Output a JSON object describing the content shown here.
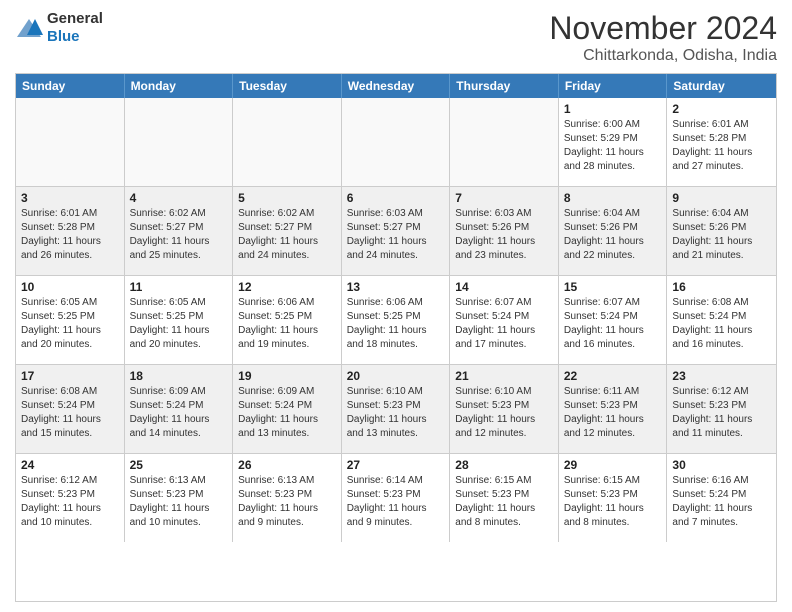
{
  "logo": {
    "general": "General",
    "blue": "Blue"
  },
  "title": "November 2024",
  "location": "Chittarkonda, Odisha, India",
  "days_of_week": [
    "Sunday",
    "Monday",
    "Tuesday",
    "Wednesday",
    "Thursday",
    "Friday",
    "Saturday"
  ],
  "weeks": [
    [
      {
        "day": "",
        "empty": true
      },
      {
        "day": "",
        "empty": true
      },
      {
        "day": "",
        "empty": true
      },
      {
        "day": "",
        "empty": true
      },
      {
        "day": "",
        "empty": true
      },
      {
        "day": "1",
        "sunrise": "6:00 AM",
        "sunset": "5:29 PM",
        "daylight": "11 hours and 28 minutes."
      },
      {
        "day": "2",
        "sunrise": "6:01 AM",
        "sunset": "5:28 PM",
        "daylight": "11 hours and 27 minutes."
      }
    ],
    [
      {
        "day": "3",
        "sunrise": "6:01 AM",
        "sunset": "5:28 PM",
        "daylight": "11 hours and 26 minutes."
      },
      {
        "day": "4",
        "sunrise": "6:02 AM",
        "sunset": "5:27 PM",
        "daylight": "11 hours and 25 minutes."
      },
      {
        "day": "5",
        "sunrise": "6:02 AM",
        "sunset": "5:27 PM",
        "daylight": "11 hours and 24 minutes."
      },
      {
        "day": "6",
        "sunrise": "6:03 AM",
        "sunset": "5:27 PM",
        "daylight": "11 hours and 24 minutes."
      },
      {
        "day": "7",
        "sunrise": "6:03 AM",
        "sunset": "5:26 PM",
        "daylight": "11 hours and 23 minutes."
      },
      {
        "day": "8",
        "sunrise": "6:04 AM",
        "sunset": "5:26 PM",
        "daylight": "11 hours and 22 minutes."
      },
      {
        "day": "9",
        "sunrise": "6:04 AM",
        "sunset": "5:26 PM",
        "daylight": "11 hours and 21 minutes."
      }
    ],
    [
      {
        "day": "10",
        "sunrise": "6:05 AM",
        "sunset": "5:25 PM",
        "daylight": "11 hours and 20 minutes."
      },
      {
        "day": "11",
        "sunrise": "6:05 AM",
        "sunset": "5:25 PM",
        "daylight": "11 hours and 20 minutes."
      },
      {
        "day": "12",
        "sunrise": "6:06 AM",
        "sunset": "5:25 PM",
        "daylight": "11 hours and 19 minutes."
      },
      {
        "day": "13",
        "sunrise": "6:06 AM",
        "sunset": "5:25 PM",
        "daylight": "11 hours and 18 minutes."
      },
      {
        "day": "14",
        "sunrise": "6:07 AM",
        "sunset": "5:24 PM",
        "daylight": "11 hours and 17 minutes."
      },
      {
        "day": "15",
        "sunrise": "6:07 AM",
        "sunset": "5:24 PM",
        "daylight": "11 hours and 16 minutes."
      },
      {
        "day": "16",
        "sunrise": "6:08 AM",
        "sunset": "5:24 PM",
        "daylight": "11 hours and 16 minutes."
      }
    ],
    [
      {
        "day": "17",
        "sunrise": "6:08 AM",
        "sunset": "5:24 PM",
        "daylight": "11 hours and 15 minutes."
      },
      {
        "day": "18",
        "sunrise": "6:09 AM",
        "sunset": "5:24 PM",
        "daylight": "11 hours and 14 minutes."
      },
      {
        "day": "19",
        "sunrise": "6:09 AM",
        "sunset": "5:24 PM",
        "daylight": "11 hours and 13 minutes."
      },
      {
        "day": "20",
        "sunrise": "6:10 AM",
        "sunset": "5:23 PM",
        "daylight": "11 hours and 13 minutes."
      },
      {
        "day": "21",
        "sunrise": "6:10 AM",
        "sunset": "5:23 PM",
        "daylight": "11 hours and 12 minutes."
      },
      {
        "day": "22",
        "sunrise": "6:11 AM",
        "sunset": "5:23 PM",
        "daylight": "11 hours and 12 minutes."
      },
      {
        "day": "23",
        "sunrise": "6:12 AM",
        "sunset": "5:23 PM",
        "daylight": "11 hours and 11 minutes."
      }
    ],
    [
      {
        "day": "24",
        "sunrise": "6:12 AM",
        "sunset": "5:23 PM",
        "daylight": "11 hours and 10 minutes."
      },
      {
        "day": "25",
        "sunrise": "6:13 AM",
        "sunset": "5:23 PM",
        "daylight": "11 hours and 10 minutes."
      },
      {
        "day": "26",
        "sunrise": "6:13 AM",
        "sunset": "5:23 PM",
        "daylight": "11 hours and 9 minutes."
      },
      {
        "day": "27",
        "sunrise": "6:14 AM",
        "sunset": "5:23 PM",
        "daylight": "11 hours and 9 minutes."
      },
      {
        "day": "28",
        "sunrise": "6:15 AM",
        "sunset": "5:23 PM",
        "daylight": "11 hours and 8 minutes."
      },
      {
        "day": "29",
        "sunrise": "6:15 AM",
        "sunset": "5:23 PM",
        "daylight": "11 hours and 8 minutes."
      },
      {
        "day": "30",
        "sunrise": "6:16 AM",
        "sunset": "5:24 PM",
        "daylight": "11 hours and 7 minutes."
      }
    ]
  ]
}
